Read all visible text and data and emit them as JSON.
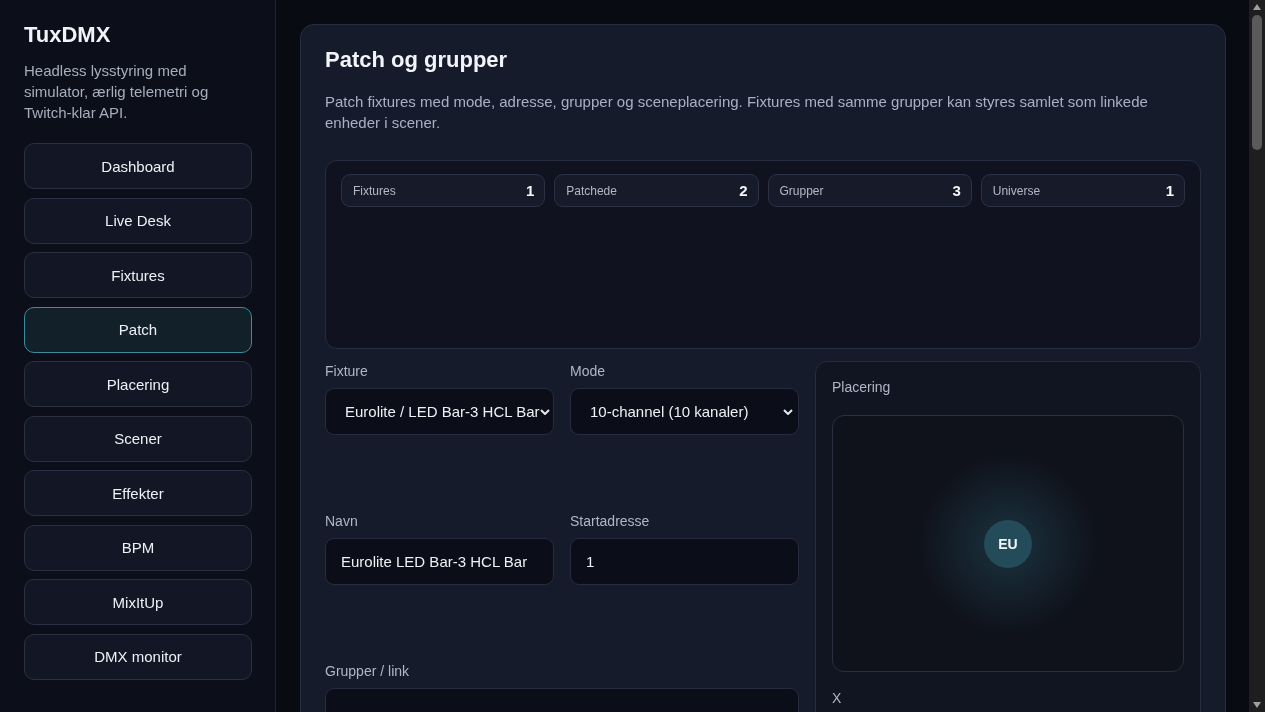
{
  "app": {
    "title": "TuxDMX",
    "tagline": "Headless lysstyring med simulator, ærlig telemetri og Twitch-klar API."
  },
  "nav": [
    {
      "label": "Dashboard",
      "selected": false
    },
    {
      "label": "Live Desk",
      "selected": false
    },
    {
      "label": "Fixtures",
      "selected": false
    },
    {
      "label": "Patch",
      "selected": true
    },
    {
      "label": "Placering",
      "selected": false
    },
    {
      "label": "Scener",
      "selected": false
    },
    {
      "label": "Effekter",
      "selected": false
    },
    {
      "label": "BPM",
      "selected": false
    },
    {
      "label": "MixItUp",
      "selected": false
    },
    {
      "label": "DMX monitor",
      "selected": false
    }
  ],
  "page": {
    "title": "Patch og grupper",
    "description": "Patch fixtures med mode, adresse, grupper og sceneplacering. Fixtures med samme grupper kan styres samlet som linkede enheder i scener."
  },
  "stats": [
    {
      "label": "Fixtures",
      "value": "1"
    },
    {
      "label": "Patchede",
      "value": "2"
    },
    {
      "label": "Grupper",
      "value": "3"
    },
    {
      "label": "Universe",
      "value": "1"
    }
  ],
  "form": {
    "fixture": {
      "label": "Fixture",
      "value": "Eurolite / LED Bar-3 HCL Bar"
    },
    "mode": {
      "label": "Mode",
      "value": "10-channel (10 kanaler)"
    },
    "name": {
      "label": "Navn",
      "value": "Eurolite LED Bar-3 HCL Bar"
    },
    "start_address": {
      "label": "Startadresse",
      "value": "1"
    },
    "groups": {
      "label": "Grupper / link"
    }
  },
  "placement": {
    "title": "Placering",
    "marker": "EU",
    "x_label": "X"
  }
}
